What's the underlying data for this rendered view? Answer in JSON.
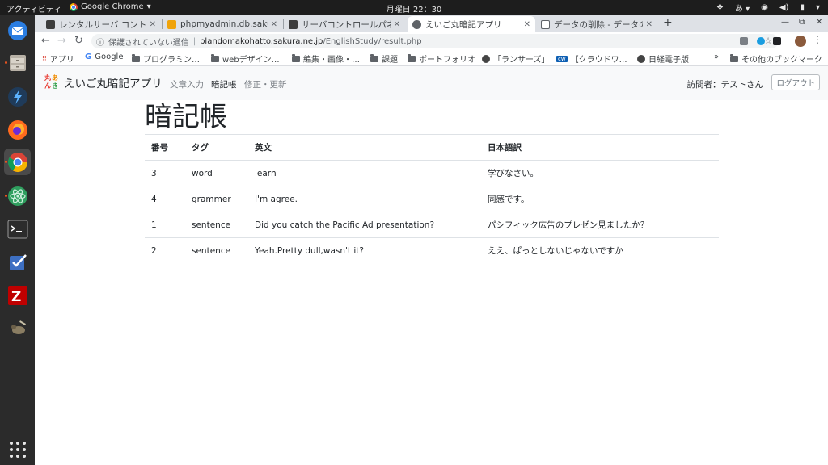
{
  "system": {
    "activities": "アクティビティ",
    "app_name": "Google Chrome",
    "clock": "月曜日 22：30",
    "input_method": "あ"
  },
  "browser": {
    "tabs": [
      {
        "title": "レンタルサーバ コントロール",
        "favicon_color": "#3c3c3c"
      },
      {
        "title": "phpmyadmin.db.sakura.n",
        "favicon_color": "#f0a30a"
      },
      {
        "title": "サーバコントロールパネル",
        "favicon_color": "#3c3c3c"
      },
      {
        "title": "えいご丸暗記アプリ",
        "favicon_color": "#5f6368"
      },
      {
        "title": "データの削除 - データの追",
        "favicon_color": "#5f6368"
      }
    ],
    "active_tab": 3,
    "address": {
      "security_label": "保護されていない通信",
      "host": "plandomakohatto.sakura.ne.jp",
      "path": "/EnglishStudy/result.php"
    },
    "bookmarks": [
      {
        "label": "アプリ",
        "icon": "apps-grid-icon"
      },
      {
        "label": "Google",
        "icon": "google-icon"
      },
      {
        "label": "プログラミン…",
        "icon": "folder-icon"
      },
      {
        "label": "webデザイン…",
        "icon": "folder-icon"
      },
      {
        "label": "編集・画像・…",
        "icon": "folder-icon"
      },
      {
        "label": "課題",
        "icon": "folder-icon"
      },
      {
        "label": "ポートフォリオ",
        "icon": "folder-icon"
      },
      {
        "label": "「ランサーズ」",
        "icon": "globe-icon"
      },
      {
        "label": "【クラウドワ…",
        "icon": "crowdworks-icon"
      },
      {
        "label": "日経電子版",
        "icon": "globe-icon"
      }
    ],
    "bookmarks_more": "»",
    "other_bookmarks": "その他のブックマーク"
  },
  "app": {
    "brand": "えいご丸暗記アプリ",
    "logo_chars": [
      "丸",
      "あ",
      "ん",
      "き"
    ],
    "nav": [
      "文章入力",
      "暗記帳",
      "修正・更新"
    ],
    "current_nav": 1,
    "visitor": "訪問者：テストさん",
    "logout_label": "ログアウト",
    "heading": "暗記帳",
    "table": {
      "headers": [
        "番号",
        "タグ",
        "英文",
        "日本語訳"
      ],
      "rows": [
        [
          "3",
          "word",
          "learn",
          "学びなさい。"
        ],
        [
          "4",
          "grammer",
          "I'm agree.",
          "同感です。"
        ],
        [
          "1",
          "sentence",
          "Did you catch the Pacific Ad presentation?",
          "パシフィック広告のプレゼン見ましたか？"
        ],
        [
          "2",
          "sentence",
          "Yeah.Pretty dull,wasn't it?",
          "ええ、ぱっとしないじゃないですか"
        ]
      ]
    }
  },
  "colors": {
    "accent_orange": "#e95420",
    "navbar_bg": "#f8f9fa"
  }
}
